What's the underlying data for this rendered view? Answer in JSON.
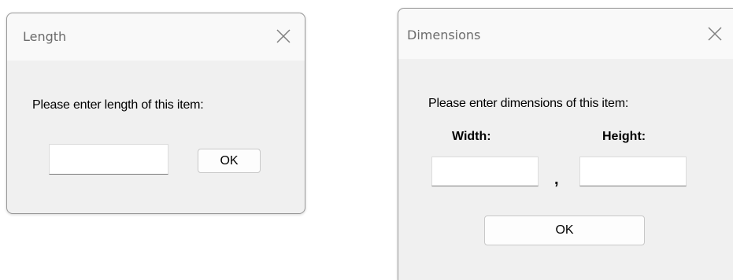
{
  "length_dialog": {
    "title": "Length",
    "close_glyph": "close-icon",
    "prompt": "Please enter length of this item:",
    "input_value": "",
    "ok_label": "OK"
  },
  "dimensions_dialog": {
    "title": "Dimensions",
    "close_glyph": "close-icon",
    "prompt": "Please enter dimensions of this item:",
    "width_label": "Width:",
    "height_label": "Height:",
    "separator": ",",
    "width_value": "",
    "height_value": "",
    "ok_label": "OK"
  },
  "colors": {
    "dialog_body": "#f0f0f0",
    "titlebar": "#f9f9f9",
    "title_text": "#6b6b6b",
    "border": "#9a9a9a"
  }
}
